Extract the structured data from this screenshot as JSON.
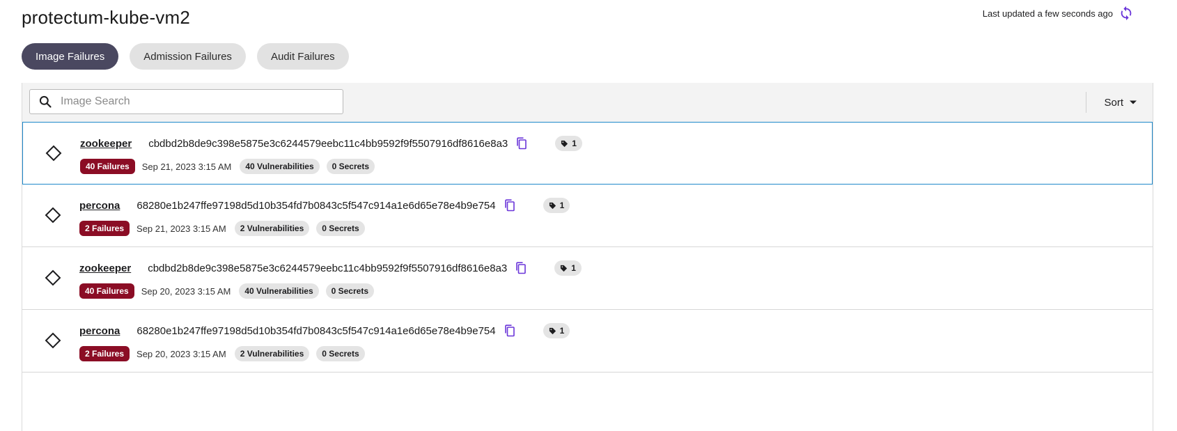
{
  "header": {
    "title": "protectum-kube-vm2",
    "last_updated": "Last updated a few seconds ago",
    "refresh_icon": "refresh-icon"
  },
  "tabs": [
    {
      "label": "Image Failures",
      "active": true
    },
    {
      "label": "Admission Failures",
      "active": false
    },
    {
      "label": "Audit Failures",
      "active": false
    }
  ],
  "toolbar": {
    "search_placeholder": "Image Search",
    "search_value": "",
    "sort_label": "Sort"
  },
  "colors": {
    "accent": "#6a35d9",
    "active_tab": "#4a4860",
    "failure_badge": "#8b0d25",
    "selected_border": "#1e88c9"
  },
  "rows": [
    {
      "name": "zookeeper",
      "digest": "cbdbd2b8de9c398e5875e3c6244579eebc11c4bb9592f9f5507916df8616e8a3",
      "tags": "1",
      "failures": "40 Failures",
      "date": "Sep 21, 2023 3:15 AM",
      "vulnerabilities": "40 Vulnerabilities",
      "secrets": "0 Secrets",
      "selected": true
    },
    {
      "name": "percona",
      "digest": "68280e1b247ffe97198d5d10b354fd7b0843c5f547c914a1e6d65e78e4b9e754",
      "tags": "1",
      "failures": "2 Failures",
      "date": "Sep 21, 2023 3:15 AM",
      "vulnerabilities": "2 Vulnerabilities",
      "secrets": "0 Secrets",
      "selected": false
    },
    {
      "name": "zookeeper",
      "digest": "cbdbd2b8de9c398e5875e3c6244579eebc11c4bb9592f9f5507916df8616e8a3",
      "tags": "1",
      "failures": "40 Failures",
      "date": "Sep 20, 2023 3:15 AM",
      "vulnerabilities": "40 Vulnerabilities",
      "secrets": "0 Secrets",
      "selected": false
    },
    {
      "name": "percona",
      "digest": "68280e1b247ffe97198d5d10b354fd7b0843c5f547c914a1e6d65e78e4b9e754",
      "tags": "1",
      "failures": "2 Failures",
      "date": "Sep 20, 2023 3:15 AM",
      "vulnerabilities": "2 Vulnerabilities",
      "secrets": "0 Secrets",
      "selected": false
    }
  ]
}
